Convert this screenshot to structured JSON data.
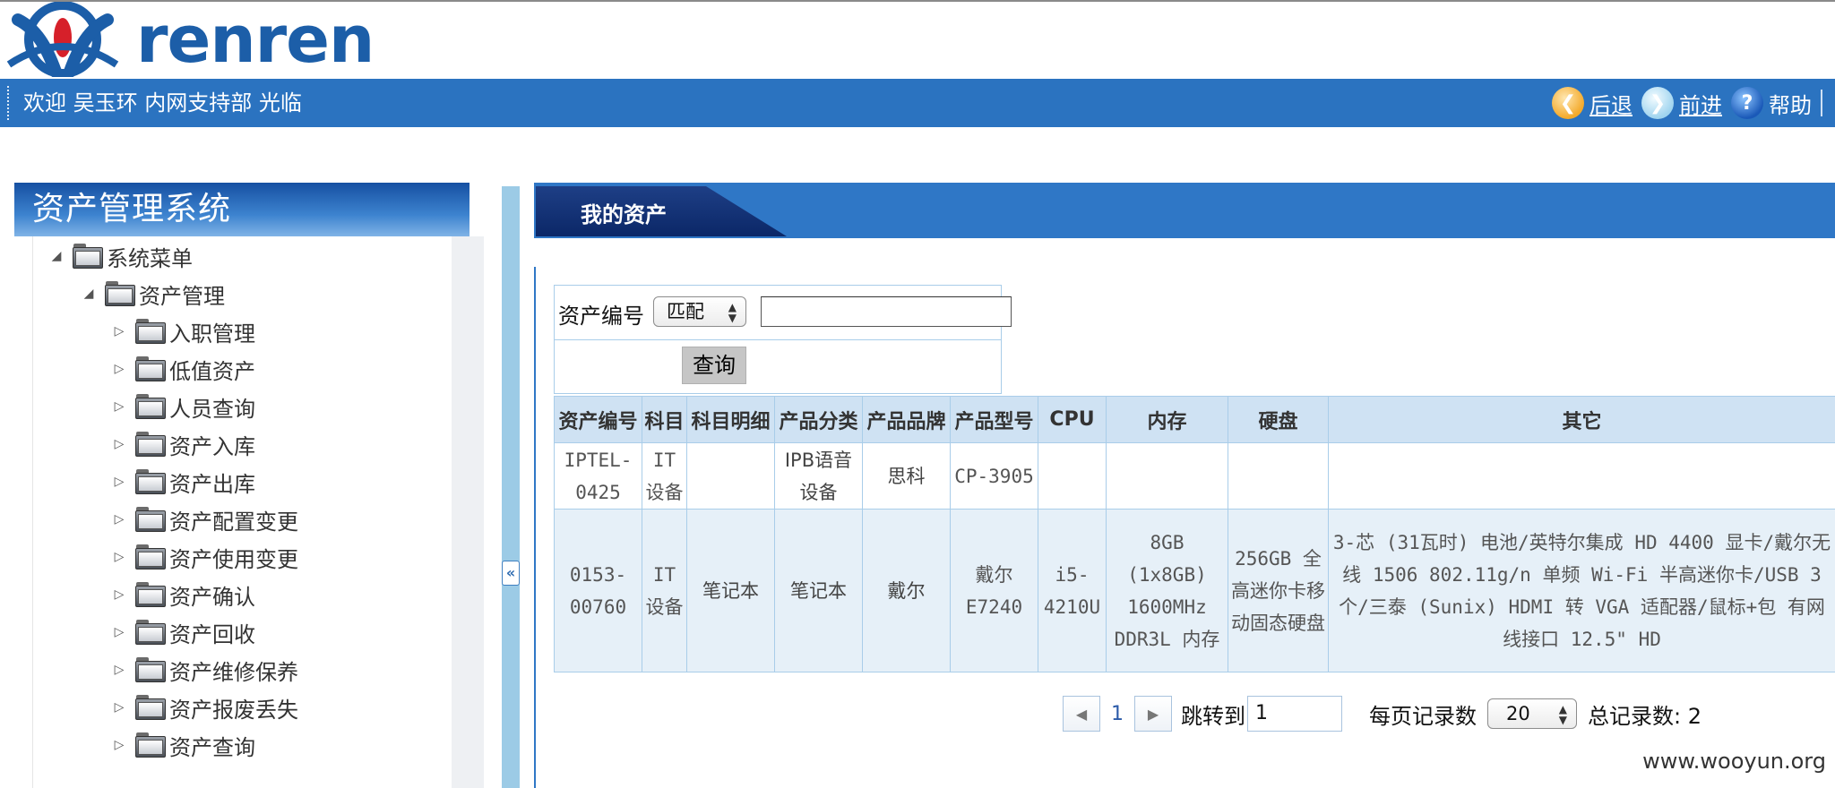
{
  "header": {
    "logo_text": "renren",
    "welcome": "欢迎 吴玉环 内网支持部 光临",
    "nav": {
      "back": "后退",
      "forward": "前进",
      "help": "帮助"
    }
  },
  "sidebar": {
    "title": "资产管理系统",
    "root": "系统菜单",
    "group": "资产管理",
    "items": [
      "入职管理",
      "低值资产",
      "人员查询",
      "资产入库",
      "资产出库",
      "资产配置变更",
      "资产使用变更",
      "资产确认",
      "资产回收",
      "资产维修保养",
      "资产报废丢失",
      "资产查询"
    ]
  },
  "main": {
    "tab": "我的资产",
    "search": {
      "label": "资产编号",
      "match_mode": "匹配",
      "value": "",
      "button": "查询"
    },
    "table": {
      "columns": [
        "资产编号",
        "科目",
        "科目明细",
        "产品分类",
        "产品品牌",
        "产品型号",
        "CPU",
        "内存",
        "硬盘",
        "其它"
      ],
      "rows": [
        [
          "IPTEL-0425",
          "IT设备",
          "",
          "IPB语音设备",
          "思科",
          "CP-3905",
          "",
          "",
          "",
          ""
        ],
        [
          "0153-00760",
          "IT设备",
          "笔记本",
          "笔记本",
          "戴尔",
          "戴尔E7240",
          "i5-4210U",
          "8GB (1x8GB) 1600MHz DDR3L 内存",
          "256GB 全高迷你卡移动固态硬盘",
          "3-芯 (31瓦时) 电池/英特尔集成 HD 4400 显卡/戴尔无线 1506 802.11g/n 单频 Wi-Fi 半高迷你卡/USB 3个/三泰 (Sunix) HDMI 转 VGA 适配器/鼠标+包 有网线接口 12.5\" HD"
        ]
      ]
    },
    "pager": {
      "page": "1",
      "jump_label": "跳转到",
      "jump_value": "1",
      "per_page_label": "每页记录数",
      "per_page": "20",
      "total": "总记录数: 2"
    }
  },
  "watermark": "www.wooyun.org",
  "colors": {
    "bar_blue": "#2b73c0",
    "header_blue": "#2f77c6",
    "tab_navy": "#0b2767",
    "table_head": "#cfe2f3",
    "row_alt": "#e6f0f8"
  }
}
